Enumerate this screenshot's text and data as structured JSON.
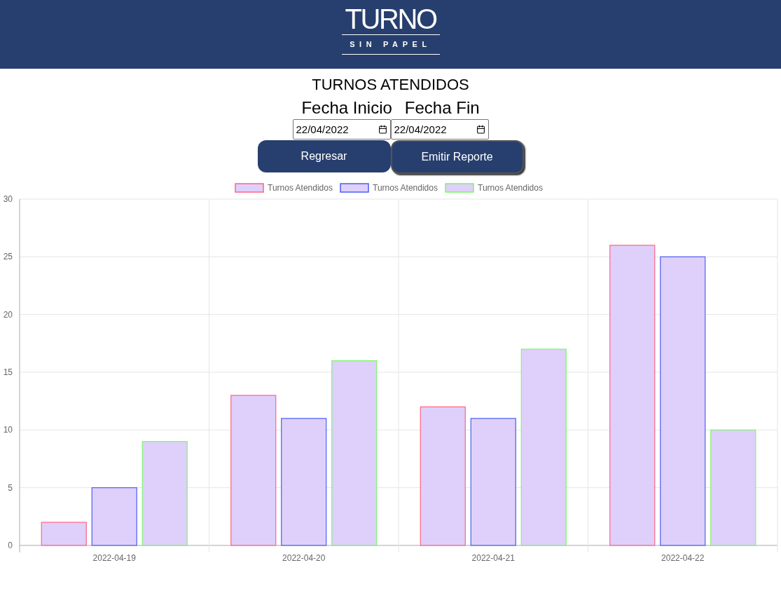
{
  "header": {
    "logo_title": "TURNO",
    "logo_subtitle": "SIN PAPEL"
  },
  "title": "TURNOS ATENDIDOS",
  "date_fields": [
    {
      "label": "Fecha Inicio",
      "value": "22/04/2022"
    },
    {
      "label": "Fecha Fin",
      "value": "22/04/2022"
    }
  ],
  "buttons": [
    {
      "label": "Regresar",
      "selected": false
    },
    {
      "label": "Emitir Reporte",
      "selected": true
    }
  ],
  "chart_data": {
    "type": "bar",
    "grid": true,
    "categories": [
      "2022-04-19",
      "2022-04-20",
      "2022-04-21",
      "2022-04-22"
    ],
    "ylim": [
      0,
      30
    ],
    "yticks": [
      0,
      5,
      10,
      15,
      20,
      25,
      30
    ],
    "series": [
      {
        "name": "Turnos Atendidos",
        "color": "#ff6384",
        "values": [
          2,
          13,
          12,
          26
        ]
      },
      {
        "name": "Turnos Atendidos",
        "color": "#4b5ff0",
        "values": [
          5,
          11,
          11,
          25
        ]
      },
      {
        "name": "Turnos Atendidos",
        "color": "#7cf56a",
        "values": [
          9,
          16,
          17,
          10
        ]
      }
    ]
  }
}
